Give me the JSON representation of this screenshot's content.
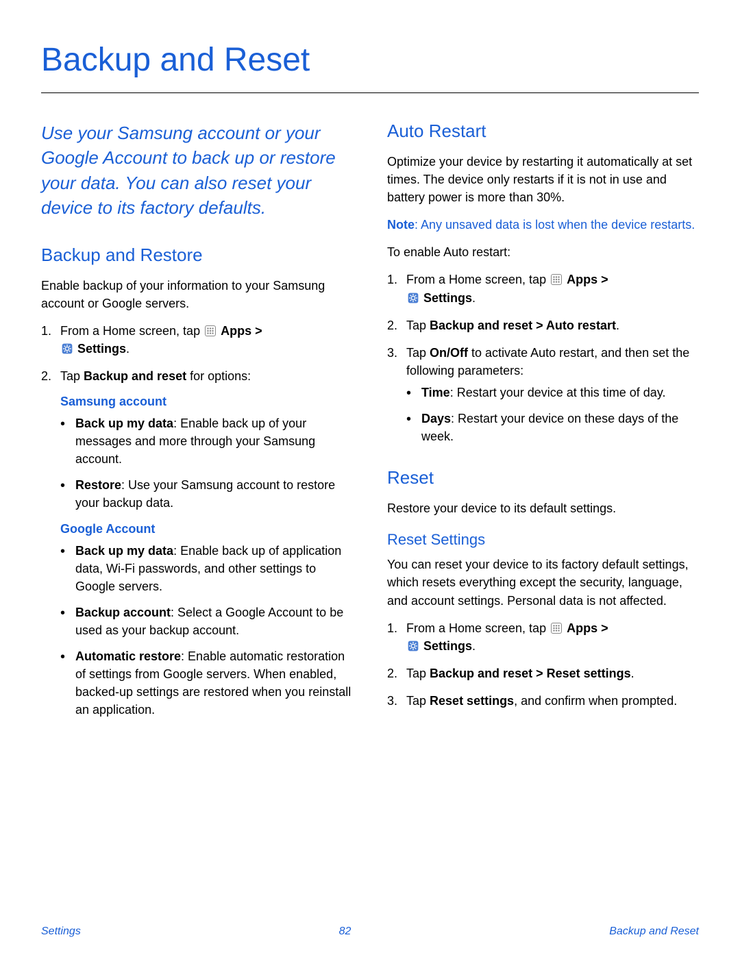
{
  "page_title": "Backup and Reset",
  "intro": "Use your Samsung account or your Google Account to back up or restore your data. You can also reset your device to its factory defaults.",
  "s_backup": {
    "heading": "Backup and Restore",
    "desc": "Enable backup of your information to your Samsung account or Google servers.",
    "step1_a": "From a Home screen, tap ",
    "apps_label": "Apps",
    "gt": " > ",
    "settings_label": "Settings",
    "period": ".",
    "step2_a": "Tap ",
    "step2_b": "Backup and reset",
    "step2_c": " for options:",
    "samsung_hd": "Samsung account",
    "samsung_b1_a": "Back up my data",
    "samsung_b1_b": ": Enable back up of your messages and more through your Samsung account.",
    "samsung_b2_a": "Restore",
    "samsung_b2_b": ": Use your Samsung account to restore your backup data.",
    "google_hd": "Google Account",
    "google_b1_a": "Back up my data",
    "google_b1_b": ": Enable back up of application data, Wi‑Fi passwords, and other settings to Google servers.",
    "google_b2_a": "Backup account",
    "google_b2_b": ": Select a Google Account to be used as your backup account.",
    "google_b3_a": "Automatic restore",
    "google_b3_b": ": Enable automatic restoration of settings from Google servers. When enabled, backed‑up settings are restored when you reinstall an application."
  },
  "s_auto": {
    "heading": "Auto Restart",
    "desc": "Optimize your device by restarting it automatically at set times. The device only restarts if it is not in use and battery power is more than 30%.",
    "note_a": "Note",
    "note_b": ": Any unsaved data is lost when the device restarts.",
    "enable": "To enable Auto restart:",
    "step2_a": "Tap ",
    "step2_b": "Backup and reset > Auto restart",
    "step2_c": ".",
    "step3_a": "Tap ",
    "step3_b": "On/Off",
    "step3_c": " to activate Auto restart, and then set the following parameters:",
    "b1_a": "Time",
    "b1_b": ": Restart your device at this time of day.",
    "b2_a": "Days",
    "b2_b": ": Restart your device on these days of the week."
  },
  "s_reset": {
    "heading": "Reset",
    "desc": "Restore your device to its default settings.",
    "sub_heading": "Reset Settings",
    "sub_desc": "You can reset your device to its factory default settings, which resets everything except the security, language, and account settings. Personal data is not affected.",
    "step2_a": "Tap ",
    "step2_b": "Backup and reset > Reset settings",
    "step2_c": ".",
    "step3_a": "Tap ",
    "step3_b": "Reset settings",
    "step3_c": ", and confirm when prompted."
  },
  "footer": {
    "left": "Settings",
    "page": "82",
    "right": "Backup and Reset"
  }
}
